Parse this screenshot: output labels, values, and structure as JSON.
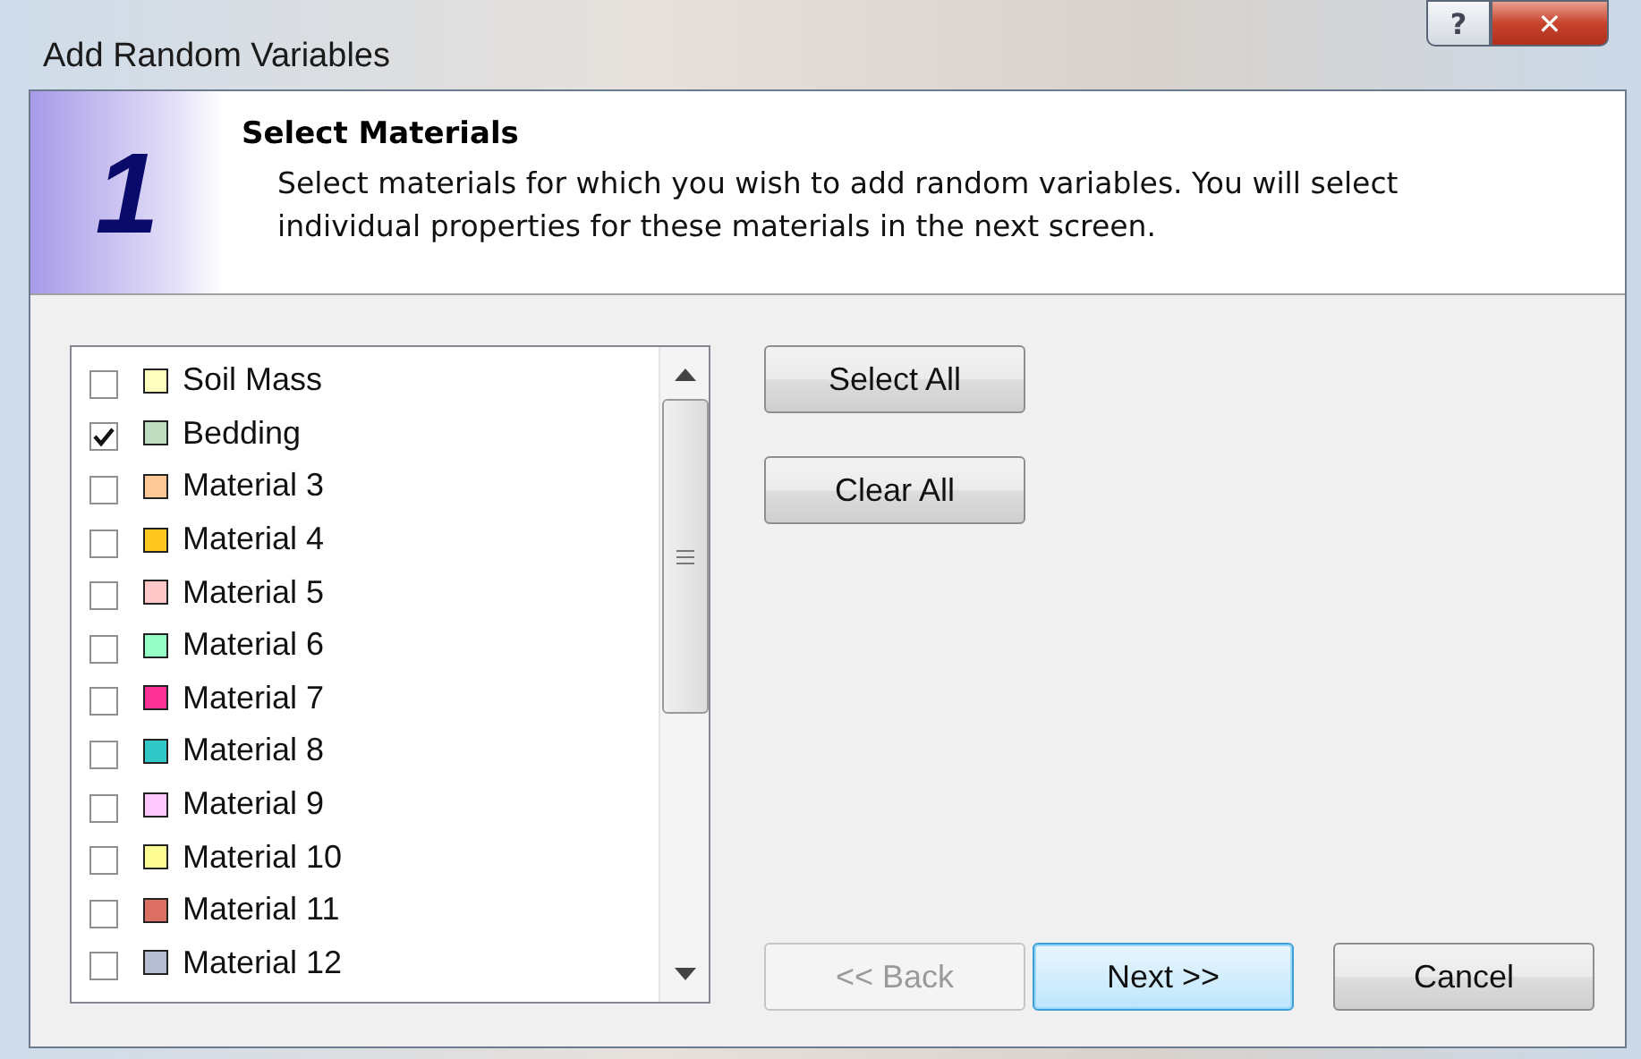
{
  "window": {
    "title": "Add Random Variables",
    "help_button": "?",
    "close_button": "✕"
  },
  "header": {
    "step": "1",
    "title": "Select Materials",
    "description": "Select materials for which you wish to add random variables. You will select individual properties for these materials in the next screen."
  },
  "materials": [
    {
      "name": "Soil Mass",
      "checked": false,
      "color": "#ffffc0"
    },
    {
      "name": "Bedding",
      "checked": true,
      "color": "#c0dcc0"
    },
    {
      "name": "Material 3",
      "checked": false,
      "color": "#ffc896"
    },
    {
      "name": "Material 4",
      "checked": false,
      "color": "#ffc820"
    },
    {
      "name": "Material 5",
      "checked": false,
      "color": "#ffc8c8"
    },
    {
      "name": "Material 6",
      "checked": false,
      "color": "#96ffc8"
    },
    {
      "name": "Material 7",
      "checked": false,
      "color": "#ff3296"
    },
    {
      "name": "Material 8",
      "checked": false,
      "color": "#32c8c8"
    },
    {
      "name": "Material 9",
      "checked": false,
      "color": "#ffc8ff"
    },
    {
      "name": "Material 10",
      "checked": false,
      "color": "#ffff96"
    },
    {
      "name": "Material 11",
      "checked": false,
      "color": "#dc7064"
    },
    {
      "name": "Material 12",
      "checked": false,
      "color": "#b4bed0"
    }
  ],
  "side_buttons": [
    {
      "label": "Select All"
    },
    {
      "label": "Clear All"
    }
  ],
  "footer_buttons": [
    {
      "label": "<< Back",
      "disabled": true,
      "default": false
    },
    {
      "label": "Next >>",
      "disabled": false,
      "default": true
    },
    {
      "label": "Cancel",
      "disabled": false,
      "default": false
    }
  ]
}
